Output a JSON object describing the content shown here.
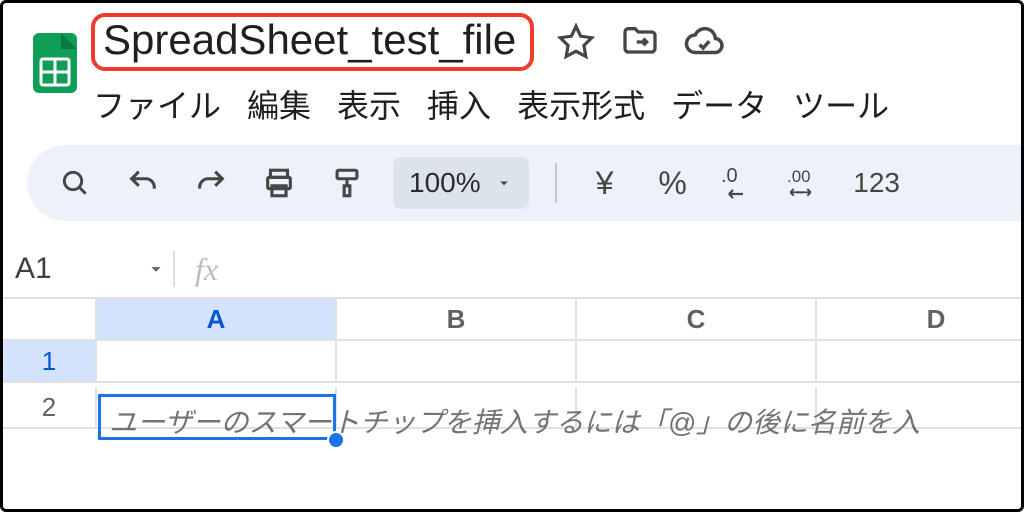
{
  "doc": {
    "title": "SpreadSheet_test_file"
  },
  "menu": {
    "file": "ファイル",
    "edit": "編集",
    "view": "表示",
    "insert": "挿入",
    "format": "表示形式",
    "data": "データ",
    "tools": "ツール"
  },
  "toolbar": {
    "zoom": "100%",
    "currency": "¥",
    "percent": "%",
    "dec_dec": ".0",
    "dec_inc": ".00",
    "numfmt": "123"
  },
  "formula_bar": {
    "name_box": "A1",
    "fx": "fx"
  },
  "grid": {
    "cols": {
      "A": "A",
      "B": "B",
      "C": "C",
      "D": "D"
    },
    "rows": {
      "r1": "1",
      "r2": "2"
    },
    "hint": "ユーザーのスマートチップを挿入するには「@」の後に名前を入"
  }
}
